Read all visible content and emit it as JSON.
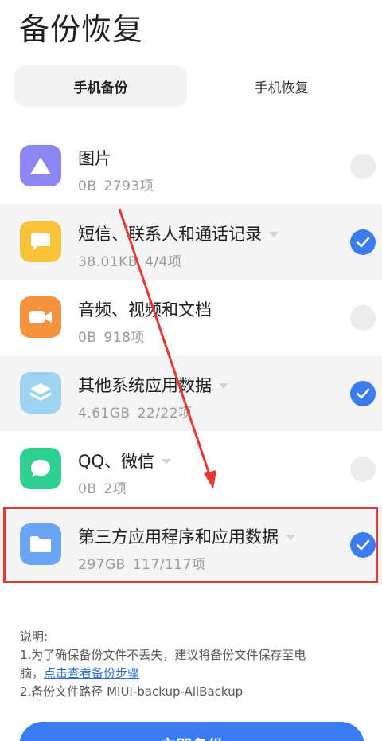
{
  "header": {
    "title": "备份恢复"
  },
  "tabs": [
    {
      "label": "手机备份",
      "active": true
    },
    {
      "label": "手机恢复",
      "active": false
    }
  ],
  "items": [
    {
      "name": "图片",
      "size": "0B",
      "count": "2793项",
      "checked": false,
      "has_caret": false,
      "icon": "image-icon",
      "icon_color": "#8c86f5"
    },
    {
      "name": "短信、联系人和通话记录",
      "size": "38.01KB",
      "count": "4/4项",
      "checked": true,
      "has_caret": true,
      "icon": "message-icon",
      "icon_color": "#f8c23a"
    },
    {
      "name": "音频、视频和文档",
      "size": "0B",
      "count": "918项",
      "checked": false,
      "has_caret": false,
      "icon": "video-icon",
      "icon_color": "#f5923e"
    },
    {
      "name": "其他系统应用数据",
      "size": "4.61GB",
      "count": "22/22项",
      "checked": true,
      "has_caret": true,
      "icon": "layers-icon",
      "icon_color": "#9fd3f2"
    },
    {
      "name": "QQ、微信",
      "size": "0B",
      "count": "2项",
      "checked": false,
      "has_caret": true,
      "icon": "chat-icon",
      "icon_color": "#2fcf91"
    },
    {
      "name": "第三方应用程序和应用数据",
      "size": "297GB",
      "count": "117/117项",
      "checked": true,
      "has_caret": true,
      "icon": "folder-icon",
      "icon_color": "#6aa6f5"
    }
  ],
  "notes": {
    "heading": "说明:",
    "line1": "1.为了确保备份文件不丢失，建议将备份文件保存至电",
    "line2_prefix": "脑，",
    "line2_link": "点击查看备份步骤",
    "line3": "2.备份文件路径 MIUI-backup-AllBackup"
  },
  "cta": {
    "label": "立即备份"
  },
  "colors": {
    "accent": "#3b7cf0",
    "highlight": "#e53935"
  }
}
